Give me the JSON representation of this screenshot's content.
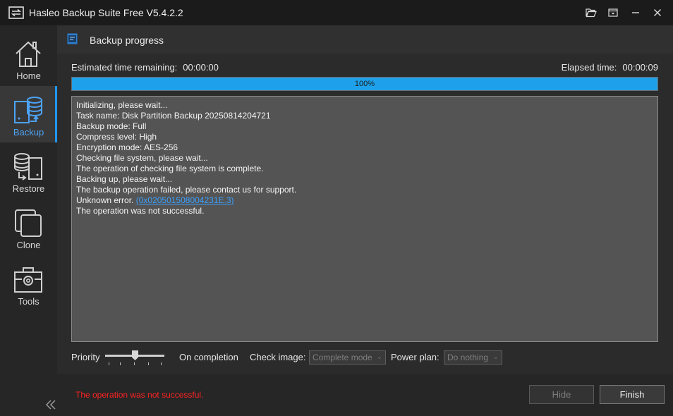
{
  "window": {
    "title": "Hasleo Backup Suite Free V5.4.2.2"
  },
  "sidebar": {
    "items": [
      {
        "label": "Home",
        "icon": "home-icon"
      },
      {
        "label": "Backup",
        "icon": "backup-icon",
        "active": true
      },
      {
        "label": "Restore",
        "icon": "restore-icon"
      },
      {
        "label": "Clone",
        "icon": "clone-icon"
      },
      {
        "label": "Tools",
        "icon": "tools-icon"
      }
    ]
  },
  "header": {
    "title": "Backup progress"
  },
  "progress": {
    "remaining_label": "Estimated time remaining:",
    "remaining_value": "00:00:00",
    "elapsed_label": "Elapsed time:",
    "elapsed_value": "00:00:09",
    "percent_text": "100%",
    "fraction": 1.0
  },
  "log": {
    "lines": [
      "Initializing, please wait...",
      "Task name: Disk Partition Backup 20250814204721",
      "Backup mode: Full",
      "Compress level: High",
      "Encryption mode: AES-256",
      "Checking file system, please wait...",
      "The operation of checking file system is complete.",
      "Backing up, please wait...",
      "The backup operation failed, please contact us for support."
    ],
    "error_prefix": "Unknown error.",
    "error_code": "(0x020501508004231E.3)",
    "final_line": "The operation was not successful."
  },
  "options": {
    "priority_label": "Priority",
    "priority_level": 0.5,
    "on_completion_label": "On completion",
    "check_image_label": "Check image:",
    "check_image_value": "Complete mode",
    "power_plan_label": "Power plan:",
    "power_plan_value": "Do nothing"
  },
  "footer": {
    "status": "The operation was not successful.",
    "hide_label": "Hide",
    "finish_label": "Finish"
  },
  "colors": {
    "accent": "#1ea1ea",
    "error": "#ff2222",
    "link": "#3ba0ff"
  }
}
